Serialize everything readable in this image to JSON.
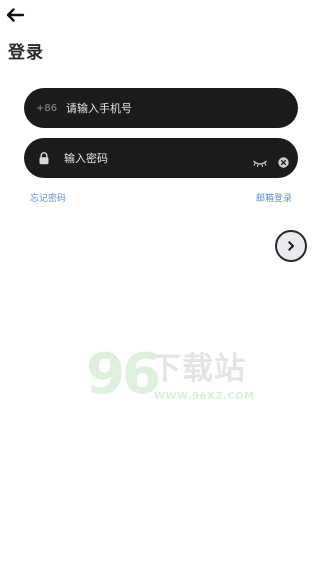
{
  "header": {
    "back_icon": "arrow-left-icon",
    "title": "登录"
  },
  "form": {
    "phone": {
      "country_code": "+86",
      "placeholder": "请输入手机号",
      "value": ""
    },
    "password": {
      "lock_icon": "lock-icon",
      "placeholder": "输入密码",
      "value": "",
      "visibility_icon": "eye-closed-icon",
      "clear_icon": "clear-icon"
    },
    "forgot_password": "忘记密码",
    "email_login": "邮箱登录",
    "next_icon": "chevron-right-icon"
  },
  "watermark": {
    "number": "96",
    "brand": "下载站",
    "url": "WWW.96XZ.COM"
  },
  "colors": {
    "pill_bg": "#1b1b1b",
    "link": "#5b8fd0",
    "next_bg": "#e9e9ee"
  }
}
